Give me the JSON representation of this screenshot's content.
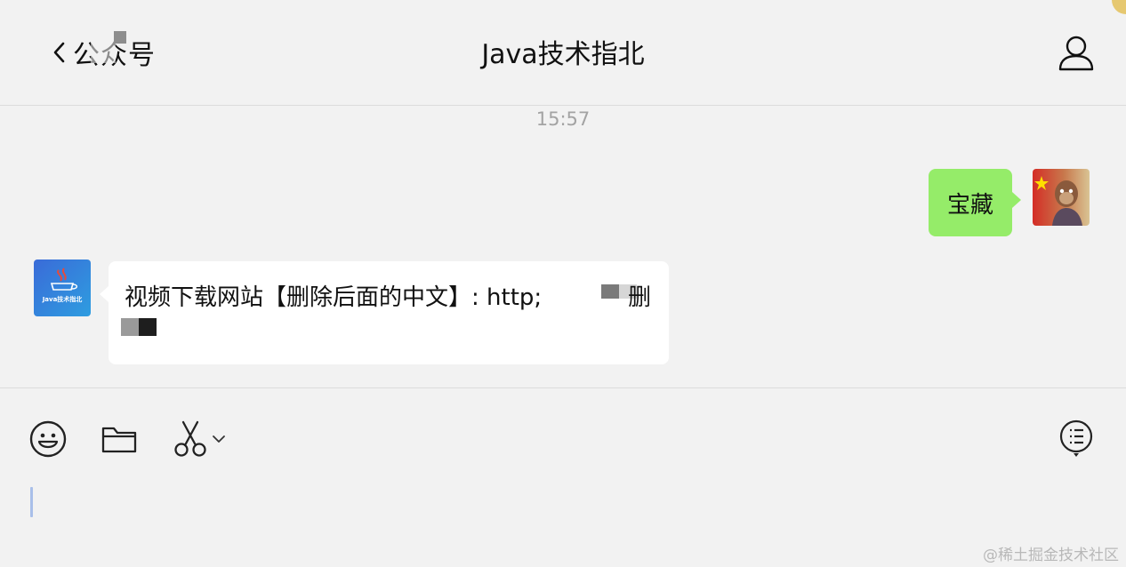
{
  "header": {
    "back_label": "公众号",
    "title": "Java技术指北",
    "back_icon": "chevron-left-icon",
    "profile_icon": "person-icon"
  },
  "chat": {
    "timestamp": "15:57",
    "messages": [
      {
        "side": "right",
        "sender": "me",
        "text": "宝藏",
        "bubble_color": "#95ec69"
      },
      {
        "side": "left",
        "sender": "Java技术指北",
        "text": "视频下载网站【删除后面的中文】: http;",
        "text_tail": "删",
        "bubble_color": "#ffffff"
      }
    ],
    "account_avatar_label": "Java技术指北"
  },
  "composer": {
    "tools": [
      "emoji-icon",
      "folder-icon",
      "scissors-icon",
      "chevron-down-icon"
    ],
    "right_tool": "chat-history-icon"
  },
  "watermark": "@稀土掘金技术社区",
  "colors": {
    "background": "#f2f2f2",
    "sent_bubble": "#95ec69",
    "received_bubble": "#ffffff",
    "caret": "#a9bfe9"
  }
}
